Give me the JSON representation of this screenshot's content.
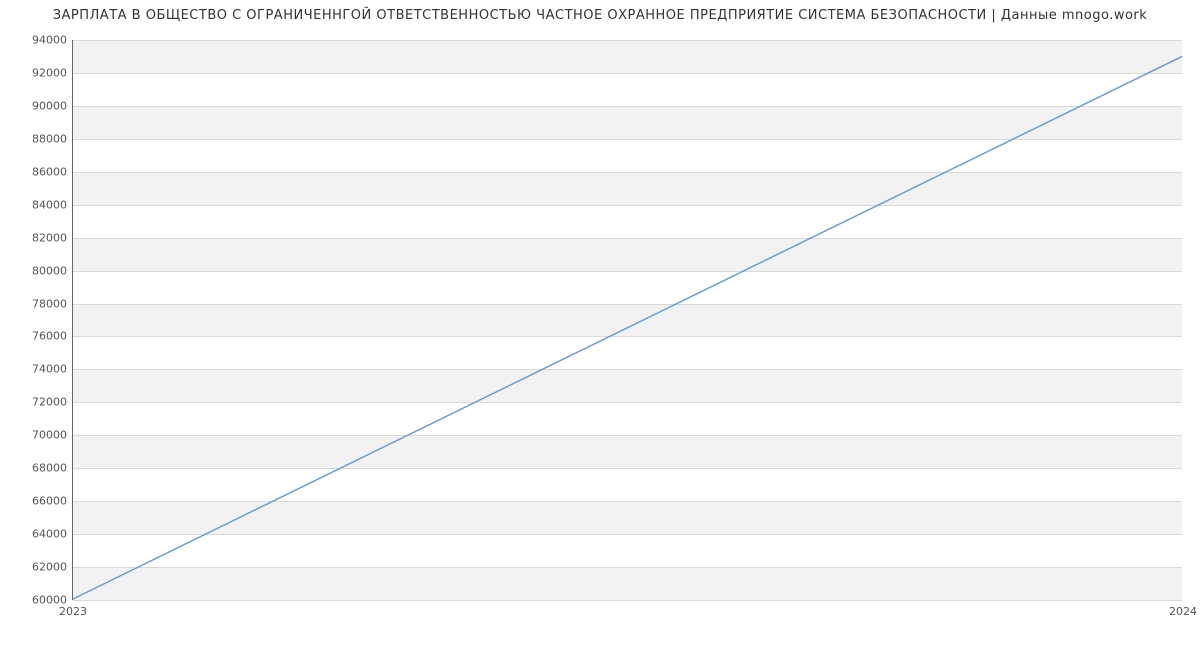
{
  "chart_data": {
    "type": "line",
    "title": "ЗАРПЛАТА В ОБЩЕСТВО С ОГРАНИЧЕННГОЙ ОТВЕТСТВЕННОСТЬЮ ЧАСТНОЕ ОХРАННОЕ ПРЕДПРИЯТИЕ СИСТЕМА БЕЗОПАСНОСТИ | Данные mnogo.work",
    "x": [
      2023,
      2024
    ],
    "series": [
      {
        "name": "Зарплата",
        "values": [
          60000,
          93000
        ],
        "color": "#6b9bd1"
      }
    ],
    "xlabel": "",
    "ylabel": "",
    "xlim": [
      2023,
      2024
    ],
    "ylim": [
      60000,
      94000
    ],
    "x_ticks": [
      2023,
      2024
    ],
    "y_ticks": [
      60000,
      62000,
      64000,
      66000,
      68000,
      70000,
      72000,
      74000,
      76000,
      78000,
      80000,
      82000,
      84000,
      86000,
      88000,
      90000,
      92000,
      94000
    ],
    "grid": {
      "y": true,
      "x": false,
      "alternating_bands": true
    }
  }
}
